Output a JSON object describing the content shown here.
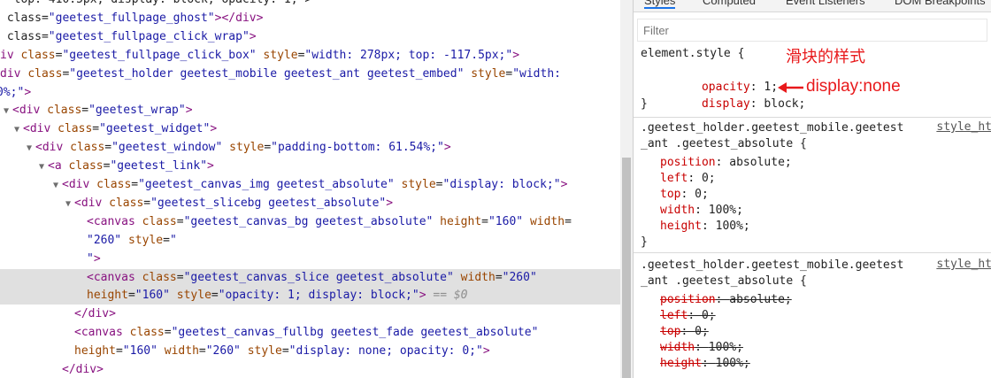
{
  "elements": {
    "lines": [
      {
        "pre": "",
        "parts": [
          {
            "c": "txt",
            "t": "  top: 410.5px; display: block; opacity: 1;\">"
          }
        ]
      },
      {
        "pre": "",
        "parts": [
          {
            "c": "txt",
            "t": " class="
          },
          {
            "c": "val",
            "t": "\"geetest_fullpage_ghost\""
          },
          {
            "c": "tag",
            "t": "></div>"
          }
        ]
      },
      {
        "pre": "",
        "parts": [
          {
            "c": "txt",
            "t": " class="
          },
          {
            "c": "val",
            "t": "\"geetest_fullpage_click_wrap\""
          },
          {
            "c": "tag",
            "t": ">"
          }
        ]
      },
      {
        "pre": "",
        "parts": [
          {
            "c": "tag",
            "t": "iv "
          },
          {
            "c": "attr",
            "t": "class"
          },
          {
            "c": "txt",
            "t": "="
          },
          {
            "c": "val",
            "t": "\"geetest_fullpage_click_box\""
          },
          {
            "c": "attr",
            "t": " style"
          },
          {
            "c": "txt",
            "t": "="
          },
          {
            "c": "val",
            "t": "\"width: 278px; top: -117.5px;\""
          },
          {
            "c": "tag",
            "t": ">"
          }
        ]
      },
      {
        "pre": "",
        "parts": [
          {
            "c": "tag",
            "t": "div "
          },
          {
            "c": "attr",
            "t": "class"
          },
          {
            "c": "txt",
            "t": "="
          },
          {
            "c": "val",
            "t": "\"geetest_holder geetest_mobile geetest_ant geetest_embed\""
          },
          {
            "c": "attr",
            "t": " style"
          },
          {
            "c": "txt",
            "t": "="
          },
          {
            "c": "val",
            "t": "\"width:"
          }
        ]
      },
      {
        "pre": "",
        "parts": [
          {
            "c": "val",
            "t": "0%;\""
          },
          {
            "c": "tag",
            "t": ">"
          }
        ]
      },
      {
        "pre": "▼",
        "parts": [
          {
            "c": "tag",
            "t": "<div "
          },
          {
            "c": "attr",
            "t": "class"
          },
          {
            "c": "txt",
            "t": "="
          },
          {
            "c": "val",
            "t": "\"geetest_wrap\""
          },
          {
            "c": "tag",
            "t": ">"
          }
        ]
      },
      {
        "pre": "▼",
        "parts": [
          {
            "c": "tag",
            "t": "<div "
          },
          {
            "c": "attr",
            "t": "class"
          },
          {
            "c": "txt",
            "t": "="
          },
          {
            "c": "val",
            "t": "\"geetest_widget\""
          },
          {
            "c": "tag",
            "t": ">"
          }
        ]
      },
      {
        "pre": "▼",
        "parts": [
          {
            "c": "tag",
            "t": "<div "
          },
          {
            "c": "attr",
            "t": "class"
          },
          {
            "c": "txt",
            "t": "="
          },
          {
            "c": "val",
            "t": "\"geetest_window\""
          },
          {
            "c": "attr",
            "t": " style"
          },
          {
            "c": "txt",
            "t": "="
          },
          {
            "c": "val",
            "t": "\"padding-bottom: 61.54%;\""
          },
          {
            "c": "tag",
            "t": ">"
          }
        ]
      },
      {
        "pre": "▼",
        "parts": [
          {
            "c": "tag",
            "t": "<a "
          },
          {
            "c": "attr",
            "t": "class"
          },
          {
            "c": "txt",
            "t": "="
          },
          {
            "c": "val",
            "t": "\"geetest_link\""
          },
          {
            "c": "tag",
            "t": ">"
          }
        ]
      },
      {
        "pre": "▼",
        "parts": [
          {
            "c": "tag",
            "t": "<div "
          },
          {
            "c": "attr",
            "t": "class"
          },
          {
            "c": "txt",
            "t": "="
          },
          {
            "c": "val",
            "t": "\"geetest_canvas_img geetest_absolute\""
          },
          {
            "c": "attr",
            "t": " style"
          },
          {
            "c": "txt",
            "t": "="
          },
          {
            "c": "val",
            "t": "\"display: block;\""
          },
          {
            "c": "tag",
            "t": ">"
          }
        ]
      },
      {
        "pre": "▼",
        "parts": [
          {
            "c": "tag",
            "t": "<div "
          },
          {
            "c": "attr",
            "t": "class"
          },
          {
            "c": "txt",
            "t": "="
          },
          {
            "c": "val",
            "t": "\"geetest_slicebg geetest_absolute\""
          },
          {
            "c": "tag",
            "t": ">"
          }
        ]
      },
      {
        "pre": "",
        "parts": [
          {
            "c": "tag",
            "t": "<canvas "
          },
          {
            "c": "attr",
            "t": "class"
          },
          {
            "c": "txt",
            "t": "="
          },
          {
            "c": "val",
            "t": "\"geetest_canvas_bg geetest_absolute\""
          },
          {
            "c": "attr",
            "t": " height"
          },
          {
            "c": "txt",
            "t": "="
          },
          {
            "c": "val",
            "t": "\"160\""
          },
          {
            "c": "attr",
            "t": " width"
          },
          {
            "c": "txt",
            "t": "="
          }
        ]
      },
      {
        "pre": "",
        "parts": [
          {
            "c": "val",
            "t": "\"260\""
          },
          {
            "c": "attr",
            "t": " style"
          },
          {
            "c": "txt",
            "t": "="
          },
          {
            "c": "val",
            "t": "\""
          }
        ]
      },
      {
        "pre": "",
        "parts": [
          {
            "c": "val",
            "t": "\""
          },
          {
            "c": "tag",
            "t": ">"
          }
        ]
      },
      {
        "pre": "",
        "parts": [
          {
            "c": "tag",
            "t": "<canvas "
          },
          {
            "c": "attr",
            "t": "class"
          },
          {
            "c": "txt",
            "t": "="
          },
          {
            "c": "val",
            "t": "\"geetest_canvas_slice geetest_absolute\""
          },
          {
            "c": "attr",
            "t": " width"
          },
          {
            "c": "txt",
            "t": "="
          },
          {
            "c": "val",
            "t": "\"260\""
          }
        ]
      },
      {
        "pre": "",
        "parts": [
          {
            "c": "attr",
            "t": "height"
          },
          {
            "c": "txt",
            "t": "="
          },
          {
            "c": "val",
            "t": "\"160\""
          },
          {
            "c": "attr",
            "t": " style"
          },
          {
            "c": "txt",
            "t": "="
          },
          {
            "c": "val",
            "t": "\"opacity: 1; display: block;\""
          },
          {
            "c": "tag",
            "t": ">"
          },
          {
            "c": "eq",
            "t": " == $0"
          }
        ]
      },
      {
        "pre": "",
        "parts": [
          {
            "c": "tag",
            "t": "</div>"
          }
        ]
      },
      {
        "pre": "",
        "parts": [
          {
            "c": "tag",
            "t": "<canvas "
          },
          {
            "c": "attr",
            "t": "class"
          },
          {
            "c": "txt",
            "t": "="
          },
          {
            "c": "val",
            "t": "\"geetest_canvas_fullbg geetest_fade geetest_absolute\""
          }
        ]
      },
      {
        "pre": "",
        "parts": [
          {
            "c": "attr",
            "t": "height"
          },
          {
            "c": "txt",
            "t": "="
          },
          {
            "c": "val",
            "t": "\"160\""
          },
          {
            "c": "attr",
            "t": " width"
          },
          {
            "c": "txt",
            "t": "="
          },
          {
            "c": "val",
            "t": "\"260\""
          },
          {
            "c": "attr",
            "t": " style"
          },
          {
            "c": "txt",
            "t": "="
          },
          {
            "c": "val",
            "t": "\"display: none; opacity: 0;\""
          },
          {
            "c": "tag",
            "t": ">"
          }
        ]
      },
      {
        "pre": "",
        "parts": [
          {
            "c": "tag",
            "t": "</div>"
          }
        ]
      }
    ]
  },
  "styles": {
    "tabs": [
      "Styles",
      "Computed",
      "Event Listeners",
      "DOM Breakpoints"
    ],
    "filter_placeholder": "Filter",
    "element_style": {
      "selector": "element.style {",
      "props": [
        {
          "name": "opacity",
          "value": "1;"
        },
        {
          "name": "display",
          "value": "block;"
        }
      ],
      "close": "}"
    },
    "annotation_cn": "滑块的样式",
    "annotation_en": "display:none",
    "rule1": {
      "selector_line1": ".geetest_holder.geetest_mobile.geetest",
      "selector_line2": "_ant .geetest_absolute {",
      "source": "style_ht",
      "props": [
        {
          "name": "position",
          "value": "absolute;"
        },
        {
          "name": "left",
          "value": "0;"
        },
        {
          "name": "top",
          "value": "0;"
        },
        {
          "name": "width",
          "value": "100%;"
        },
        {
          "name": "height",
          "value": "100%;"
        }
      ],
      "close": "}"
    },
    "rule2": {
      "selector_line1": ".geetest_holder.geetest_mobile.geetest",
      "selector_line2": "_ant .geetest_absolute {",
      "source": "style_ht",
      "props": [
        {
          "name": "position",
          "value": "absolute;"
        },
        {
          "name": "left",
          "value": "0;"
        },
        {
          "name": "top",
          "value": "0;"
        },
        {
          "name": "width",
          "value": "100%;"
        },
        {
          "name": "height",
          "value": "100%;"
        }
      ]
    }
  },
  "colors": {
    "tag": "#881280",
    "attr": "#994500",
    "value": "#1a1aa6",
    "prop_name": "#c80000",
    "annotation": "#e8191b",
    "selected_row": "#e0e0e0"
  }
}
